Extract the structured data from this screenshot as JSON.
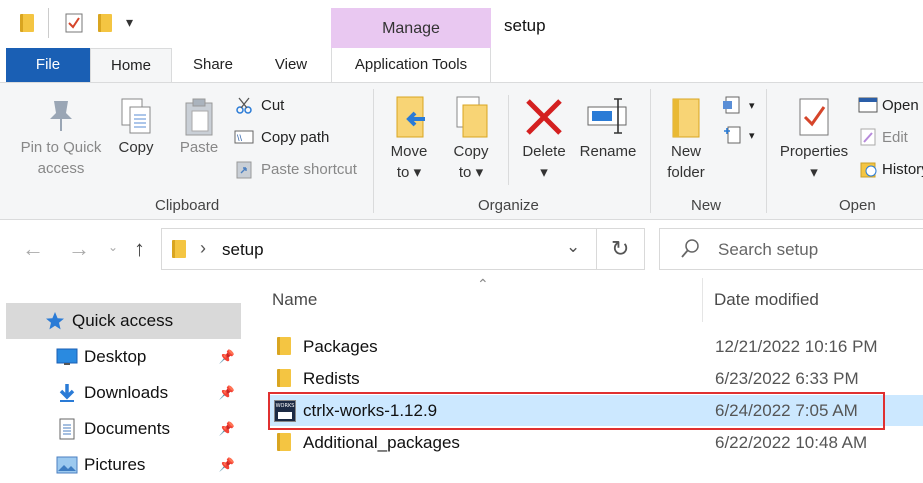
{
  "window": {
    "title": "setup",
    "contextual_tab_group": "Manage"
  },
  "tabs": {
    "file": "File",
    "home": "Home",
    "share": "Share",
    "view": "View",
    "application_tools": "Application Tools"
  },
  "ribbon": {
    "clipboard": {
      "group_label": "Clipboard",
      "pin_line1": "Pin to Quick",
      "pin_line2": "access",
      "copy": "Copy",
      "paste": "Paste",
      "cut": "Cut",
      "copy_path": "Copy path",
      "paste_shortcut": "Paste shortcut"
    },
    "organize": {
      "group_label": "Organize",
      "move_to_line1": "Move",
      "move_to_line2": "to",
      "copy_to_line1": "Copy",
      "copy_to_line2": "to",
      "delete": "Delete",
      "rename": "Rename"
    },
    "new": {
      "group_label": "New",
      "new_folder_line1": "New",
      "new_folder_line2": "folder"
    },
    "open": {
      "group_label": "Open",
      "properties": "Properties",
      "open": "Open",
      "edit": "Edit",
      "history": "History"
    }
  },
  "address": {
    "path_segment": "setup",
    "search_placeholder": "Search setup"
  },
  "nav_pane": {
    "items": [
      {
        "label": "Quick access",
        "icon": "star-icon",
        "selected": true
      },
      {
        "label": "Desktop",
        "icon": "desktop-icon",
        "pinned": true
      },
      {
        "label": "Downloads",
        "icon": "download-icon",
        "pinned": true
      },
      {
        "label": "Documents",
        "icon": "documents-icon",
        "pinned": true
      },
      {
        "label": "Pictures",
        "icon": "pictures-icon",
        "pinned": true
      }
    ]
  },
  "content": {
    "columns": {
      "name": "Name",
      "date_modified": "Date modified"
    },
    "rows": [
      {
        "name": "Packages",
        "date": "12/21/2022 10:16 PM",
        "type": "folder"
      },
      {
        "name": "Redists",
        "date": "6/23/2022 6:33 PM",
        "type": "folder"
      },
      {
        "name": "ctrlx-works-1.12.9",
        "date": "6/24/2022 7:05 AM",
        "type": "application",
        "selected": true,
        "icon_text": "WORKS"
      },
      {
        "name": "Additional_packages",
        "date": "6/22/2022 10:48 AM",
        "type": "folder"
      }
    ]
  },
  "colors": {
    "file_tab": "#1a5fb4",
    "manage_context": "#e9c8f1",
    "selection": "#cce8ff",
    "highlight_box": "#e03030",
    "folder": "#f4c542"
  }
}
